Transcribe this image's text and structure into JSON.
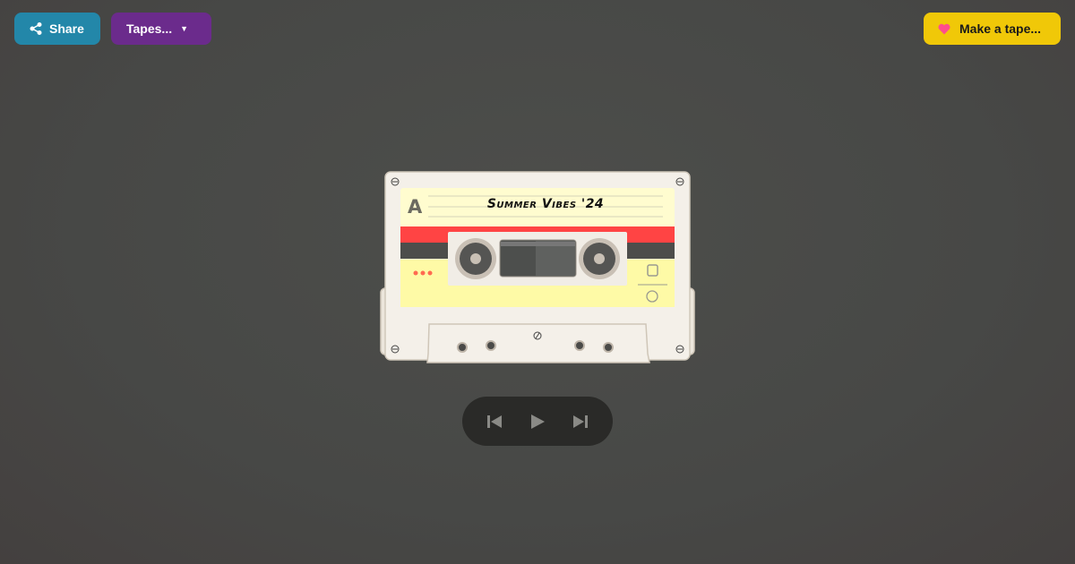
{
  "toolbar": {
    "share_label": "Share",
    "tapes_label": "Tapes...",
    "make_label": "Make a tape..."
  },
  "cassette": {
    "side": "A",
    "title": "Summer Vibes '24"
  },
  "player": {
    "controls": [
      "previous",
      "play",
      "next"
    ]
  },
  "colors": {
    "share": "#2387a9",
    "tapes": "#6b2b8c",
    "make": "#f0c808",
    "heart": "#ff4d8d",
    "label_stripe": "#ff4444"
  }
}
